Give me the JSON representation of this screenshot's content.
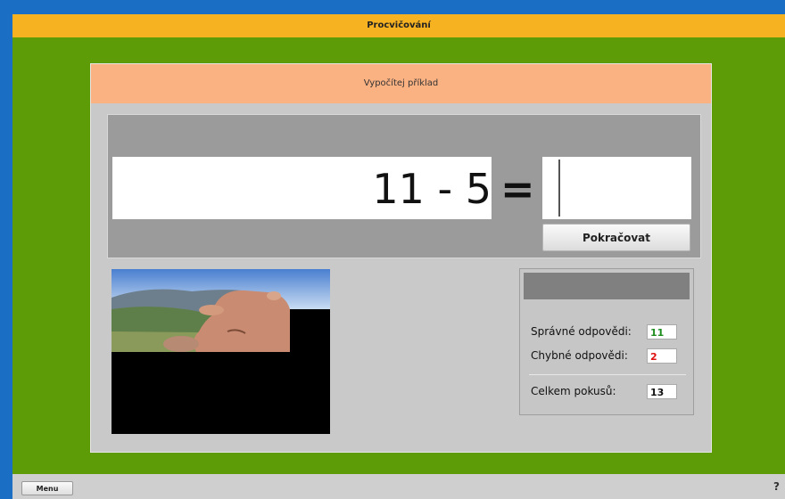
{
  "window": {
    "title": "Procvičování"
  },
  "panel": {
    "header": "Vypočítej příklad"
  },
  "problem": {
    "expression": "11 - 5",
    "equals": "=",
    "answer": ""
  },
  "buttons": {
    "continue_label": "Pokračovat",
    "menu_label": "Menu",
    "help_label": "?"
  },
  "stats": {
    "correct_label": "Správné odpovědi:",
    "correct_value": "11",
    "wrong_label": "Chybné odpovědi:",
    "wrong_value": "2",
    "total_label": "Celkem pokusů:",
    "total_value": "13"
  },
  "colors": {
    "title_bar": "#f6b221",
    "background": "#5d9c07",
    "header": "#fbb283",
    "correct": "#1e8c1e",
    "wrong": "#e01010"
  }
}
